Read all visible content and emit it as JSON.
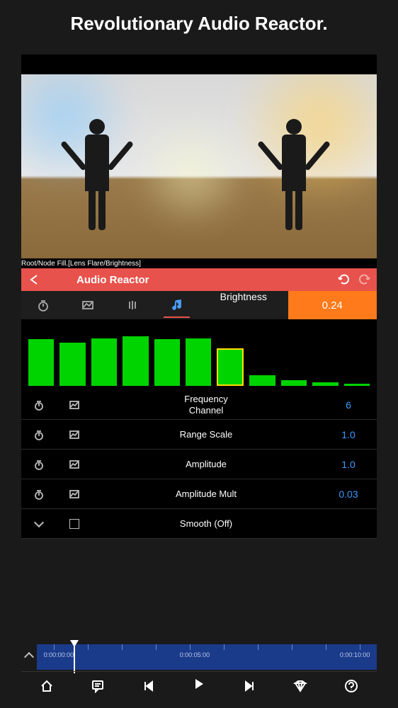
{
  "page_title": "Revolutionary Audio Reactor.",
  "breadcrumb": "Root/Node Fill.[Lens Flare/Brightness]",
  "titlebar": {
    "title": "Audio Reactor"
  },
  "tabs": {
    "brightness_label": "Brightness",
    "brightness_value": "0.24"
  },
  "eq": {
    "bars": [
      80,
      75,
      82,
      85,
      80,
      82,
      65,
      18,
      10,
      6,
      4
    ],
    "selected_index": 6
  },
  "params": [
    {
      "label": "Frequency\nChannel",
      "value": "6",
      "stopwatch": true,
      "graph": true
    },
    {
      "label": "Range Scale",
      "value": "1.0",
      "stopwatch": true,
      "graph": true
    },
    {
      "label": "Amplitude",
      "value": "1.0",
      "stopwatch": true,
      "graph": true
    },
    {
      "label": "Amplitude Mult",
      "value": "0.03",
      "stopwatch": true,
      "graph": true
    },
    {
      "label": "Smooth (Off)",
      "value": "",
      "stopwatch": false,
      "graph": false
    }
  ],
  "timeline": {
    "t0": "0:00:00:00",
    "t1": "0:00:05:00",
    "t2": "0:00:10:00"
  }
}
